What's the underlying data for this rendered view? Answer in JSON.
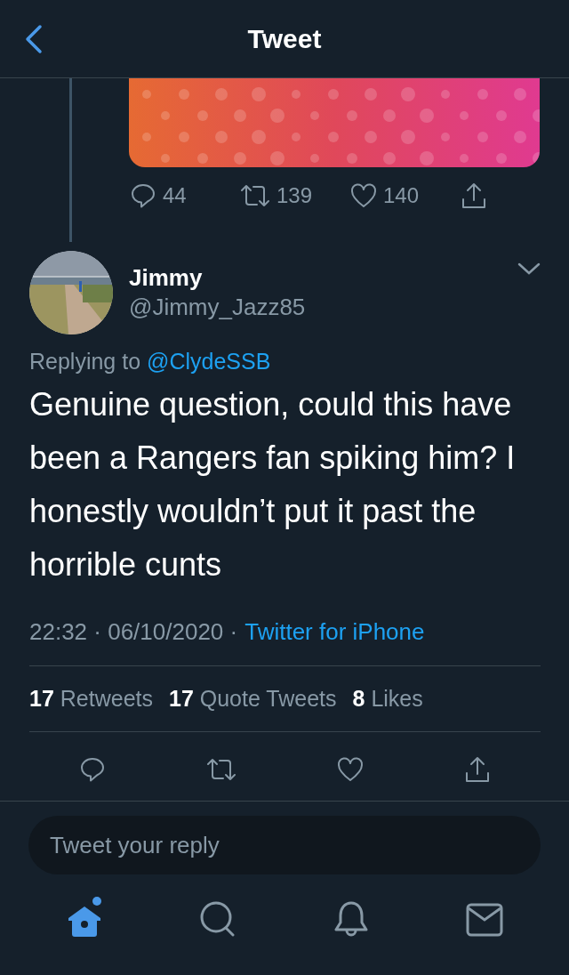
{
  "header": {
    "title": "Tweet"
  },
  "parent_tweet": {
    "actions": [
      {
        "kind": "reply",
        "count": "44"
      },
      {
        "kind": "retweet",
        "count": "139"
      },
      {
        "kind": "like",
        "count": "140"
      },
      {
        "kind": "share"
      }
    ]
  },
  "tweet": {
    "name": "Jimmy",
    "handle": "@Jimmy_Jazz85",
    "replying_prefix": "Replying to",
    "replying_to": "@ClydeSSB",
    "text": "Genuine question, could this have been a Rangers fan spiking him? I honestly wouldn’t put it past the horrible cunts",
    "timestamp": "22:32 · 06/10/2020 ·",
    "source": "Twitter for iPhone",
    "stats": [
      {
        "count": "17",
        "label": "Retweets"
      },
      {
        "count": "17",
        "label": "Quote Tweets"
      },
      {
        "count": "8",
        "label": "Likes"
      }
    ],
    "actions": [
      {
        "kind": "reply"
      },
      {
        "kind": "retweet"
      },
      {
        "kind": "like"
      },
      {
        "kind": "share"
      }
    ]
  },
  "reply_field": {
    "placeholder": "Tweet your reply"
  },
  "tab_bar": [
    {
      "kind": "home",
      "selected": true,
      "notification_dot": true
    },
    {
      "kind": "search",
      "selected": false,
      "notification_dot": false
    },
    {
      "kind": "notifications",
      "selected": false,
      "notification_dot": false
    },
    {
      "kind": "messages",
      "selected": false,
      "notification_dot": false
    }
  ]
}
